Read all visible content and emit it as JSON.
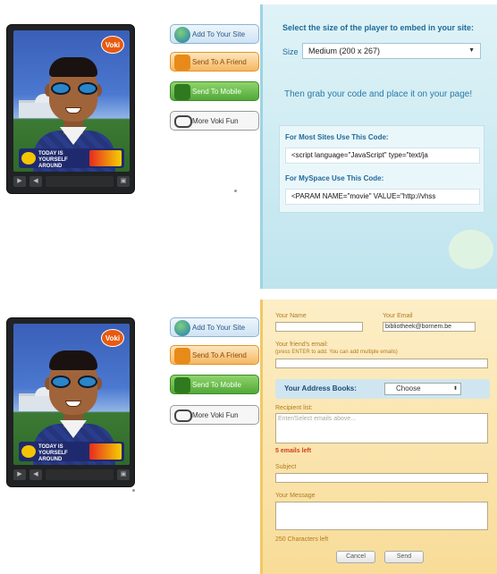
{
  "players": [
    {
      "badge": "Voki",
      "banner": "Today is yourself around",
      "controls": [
        "▶",
        "◀",
        "",
        "▣"
      ]
    },
    {
      "badge": "Voki",
      "banner": "Today is yourself around",
      "controls": [
        "▶",
        "◀",
        "",
        "▣"
      ]
    }
  ],
  "actions_top": {
    "add": "Add To Your Site",
    "friend": "Send To A Friend",
    "mobile": "Send To Mobile",
    "fun": "More Voki Fun"
  },
  "actions_bottom": {
    "add": "Add To Your Site",
    "friend": "Send To A Friend",
    "mobile": "Send To Mobile",
    "fun": "More Voki Fun"
  },
  "embed": {
    "title": "Select the size of the player to embed in your site:",
    "size_label": "Size",
    "size_value": "Medium (200 x 267)",
    "grab_text": "Then grab your code and place it on your page!",
    "most_sites_heading": "For Most Sites Use This Code:",
    "most_sites_code": "<script language=\"JavaScript\" type=\"text/ja",
    "myspace_heading": "For MySpace Use This Code:",
    "myspace_code": "<PARAM NAME=\"movie\" VALUE=\"http://vhss"
  },
  "send_friend": {
    "your_name_label": "Your Name",
    "your_name_value": "",
    "your_email_label": "Your Email",
    "your_email_value": "bibliotheek@bornem.be",
    "friends_email_label": "Your friend's email:",
    "friends_email_hint": "(press ENTER to add. You can add multiple emails)",
    "friends_email_value": "",
    "address_books_label": "Your Address Books:",
    "address_books_value": "Choose",
    "recipient_list_label": "Recipient list:",
    "recipient_list_placeholder": "Enter/Select emails above...",
    "emails_left": "5 emails left",
    "subject_label": "Subject",
    "subject_value": "",
    "message_label": "Your Message",
    "message_value": "",
    "chars_left": "250 Characters left",
    "cancel_label": "Cancel",
    "send_label": "Send"
  }
}
